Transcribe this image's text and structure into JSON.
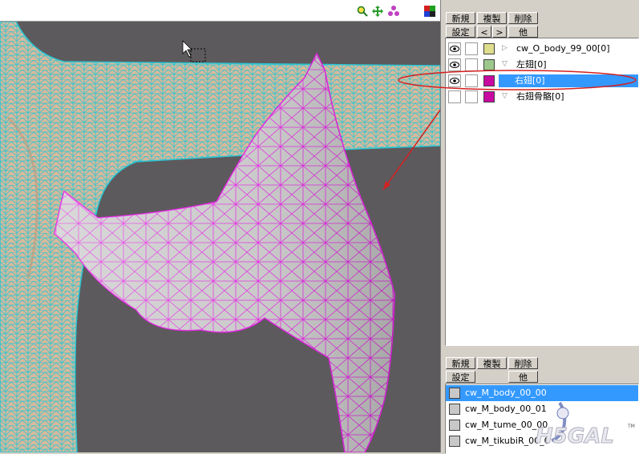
{
  "viewport": {
    "title": "",
    "tools": [
      "zoom-icon",
      "move-icon",
      "rotate-icon",
      "color-icon"
    ],
    "background": "#5d5a5d",
    "body_mesh_color": "#29c6d4",
    "wing_mesh_color": "#e01ee0"
  },
  "objects_panel": {
    "buttons": {
      "new": "新規",
      "copy": "複製",
      "delete": "削除",
      "settings": "設定",
      "prev": "<",
      "next": ">",
      "other": "他"
    },
    "items": [
      {
        "name": "cw_O_body_99_00[0]",
        "color": "#dede8c",
        "visible": true,
        "expand": "▷",
        "selected": false
      },
      {
        "name": "左翅[0]",
        "color": "#9cc88c",
        "visible": true,
        "expand": "▽",
        "selected": false
      },
      {
        "name": "右翅[0]",
        "color": "#c80aa0",
        "visible": true,
        "expand": "▼",
        "selected": true
      },
      {
        "name": "右翅骨骼[0]",
        "color": "#c80aa0",
        "visible": false,
        "expand": "▽",
        "selected": false
      }
    ],
    "annotation_color": "#d42020"
  },
  "materials_panel": {
    "buttons": {
      "new": "新規",
      "copy": "複製",
      "delete": "削除",
      "settings": "設定",
      "other": "他"
    },
    "items": [
      {
        "name": "cw_M_body_00_00",
        "selected": true
      },
      {
        "name": "cw_M_body_00_01",
        "selected": false
      },
      {
        "name": "cw_M_tume_00_00",
        "selected": false
      },
      {
        "name": "cw_M_tikubiR_00_0",
        "selected": false
      }
    ]
  },
  "watermark": {
    "text": "H5GAL",
    "tm": "TM"
  }
}
